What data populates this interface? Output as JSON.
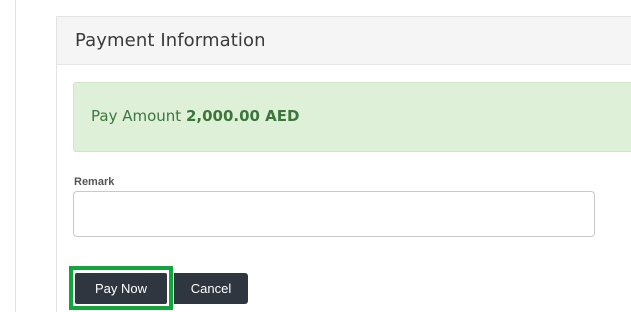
{
  "panel": {
    "title": "Payment Information"
  },
  "alert": {
    "prefix": "Pay Amount",
    "amount": "2,000.00 AED",
    "color": "#3c763d",
    "background": "#dff0d8"
  },
  "form": {
    "remark_label": "Remark",
    "remark_value": "",
    "remark_placeholder": ""
  },
  "actions": {
    "pay_label": "Pay Now",
    "cancel_label": "Cancel",
    "button_color": "#2f3640",
    "highlight_color": "#12a53d"
  }
}
